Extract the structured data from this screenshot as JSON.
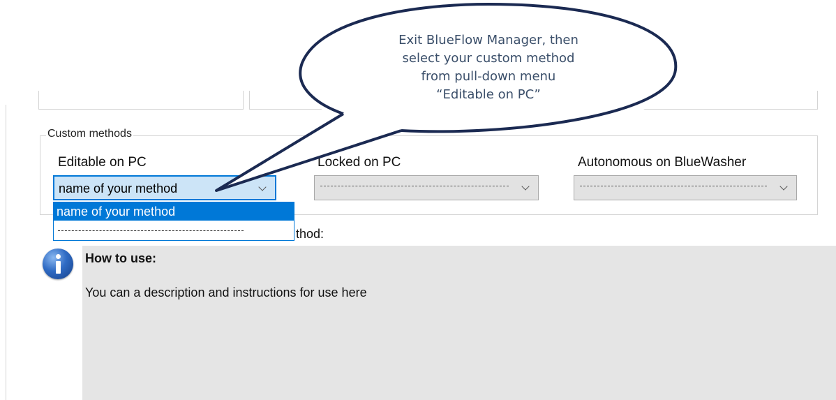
{
  "custom_methods": {
    "legend": "Custom methods",
    "editable": {
      "label": "Editable on PC",
      "value": "name of your method"
    },
    "locked": {
      "label": "Locked on PC",
      "value": "--------------------------------------"
    },
    "autonomous": {
      "label": "Autonomous on BlueWasher",
      "value": "--------------------------------------"
    },
    "dropdown_options": [
      "name of your method",
      "--------------------------------------"
    ]
  },
  "partial_label": "thod:",
  "description": {
    "title": "How to use:",
    "text": "You can a description and instructions for use here"
  },
  "callout": {
    "lines": [
      "Exit BlueFlow Manager, then",
      "select your custom method",
      "from pull-down menu",
      "“Editable on PC”"
    ]
  },
  "colors": {
    "accent": "#0078d7",
    "callout_outline": "#1b2a52"
  }
}
